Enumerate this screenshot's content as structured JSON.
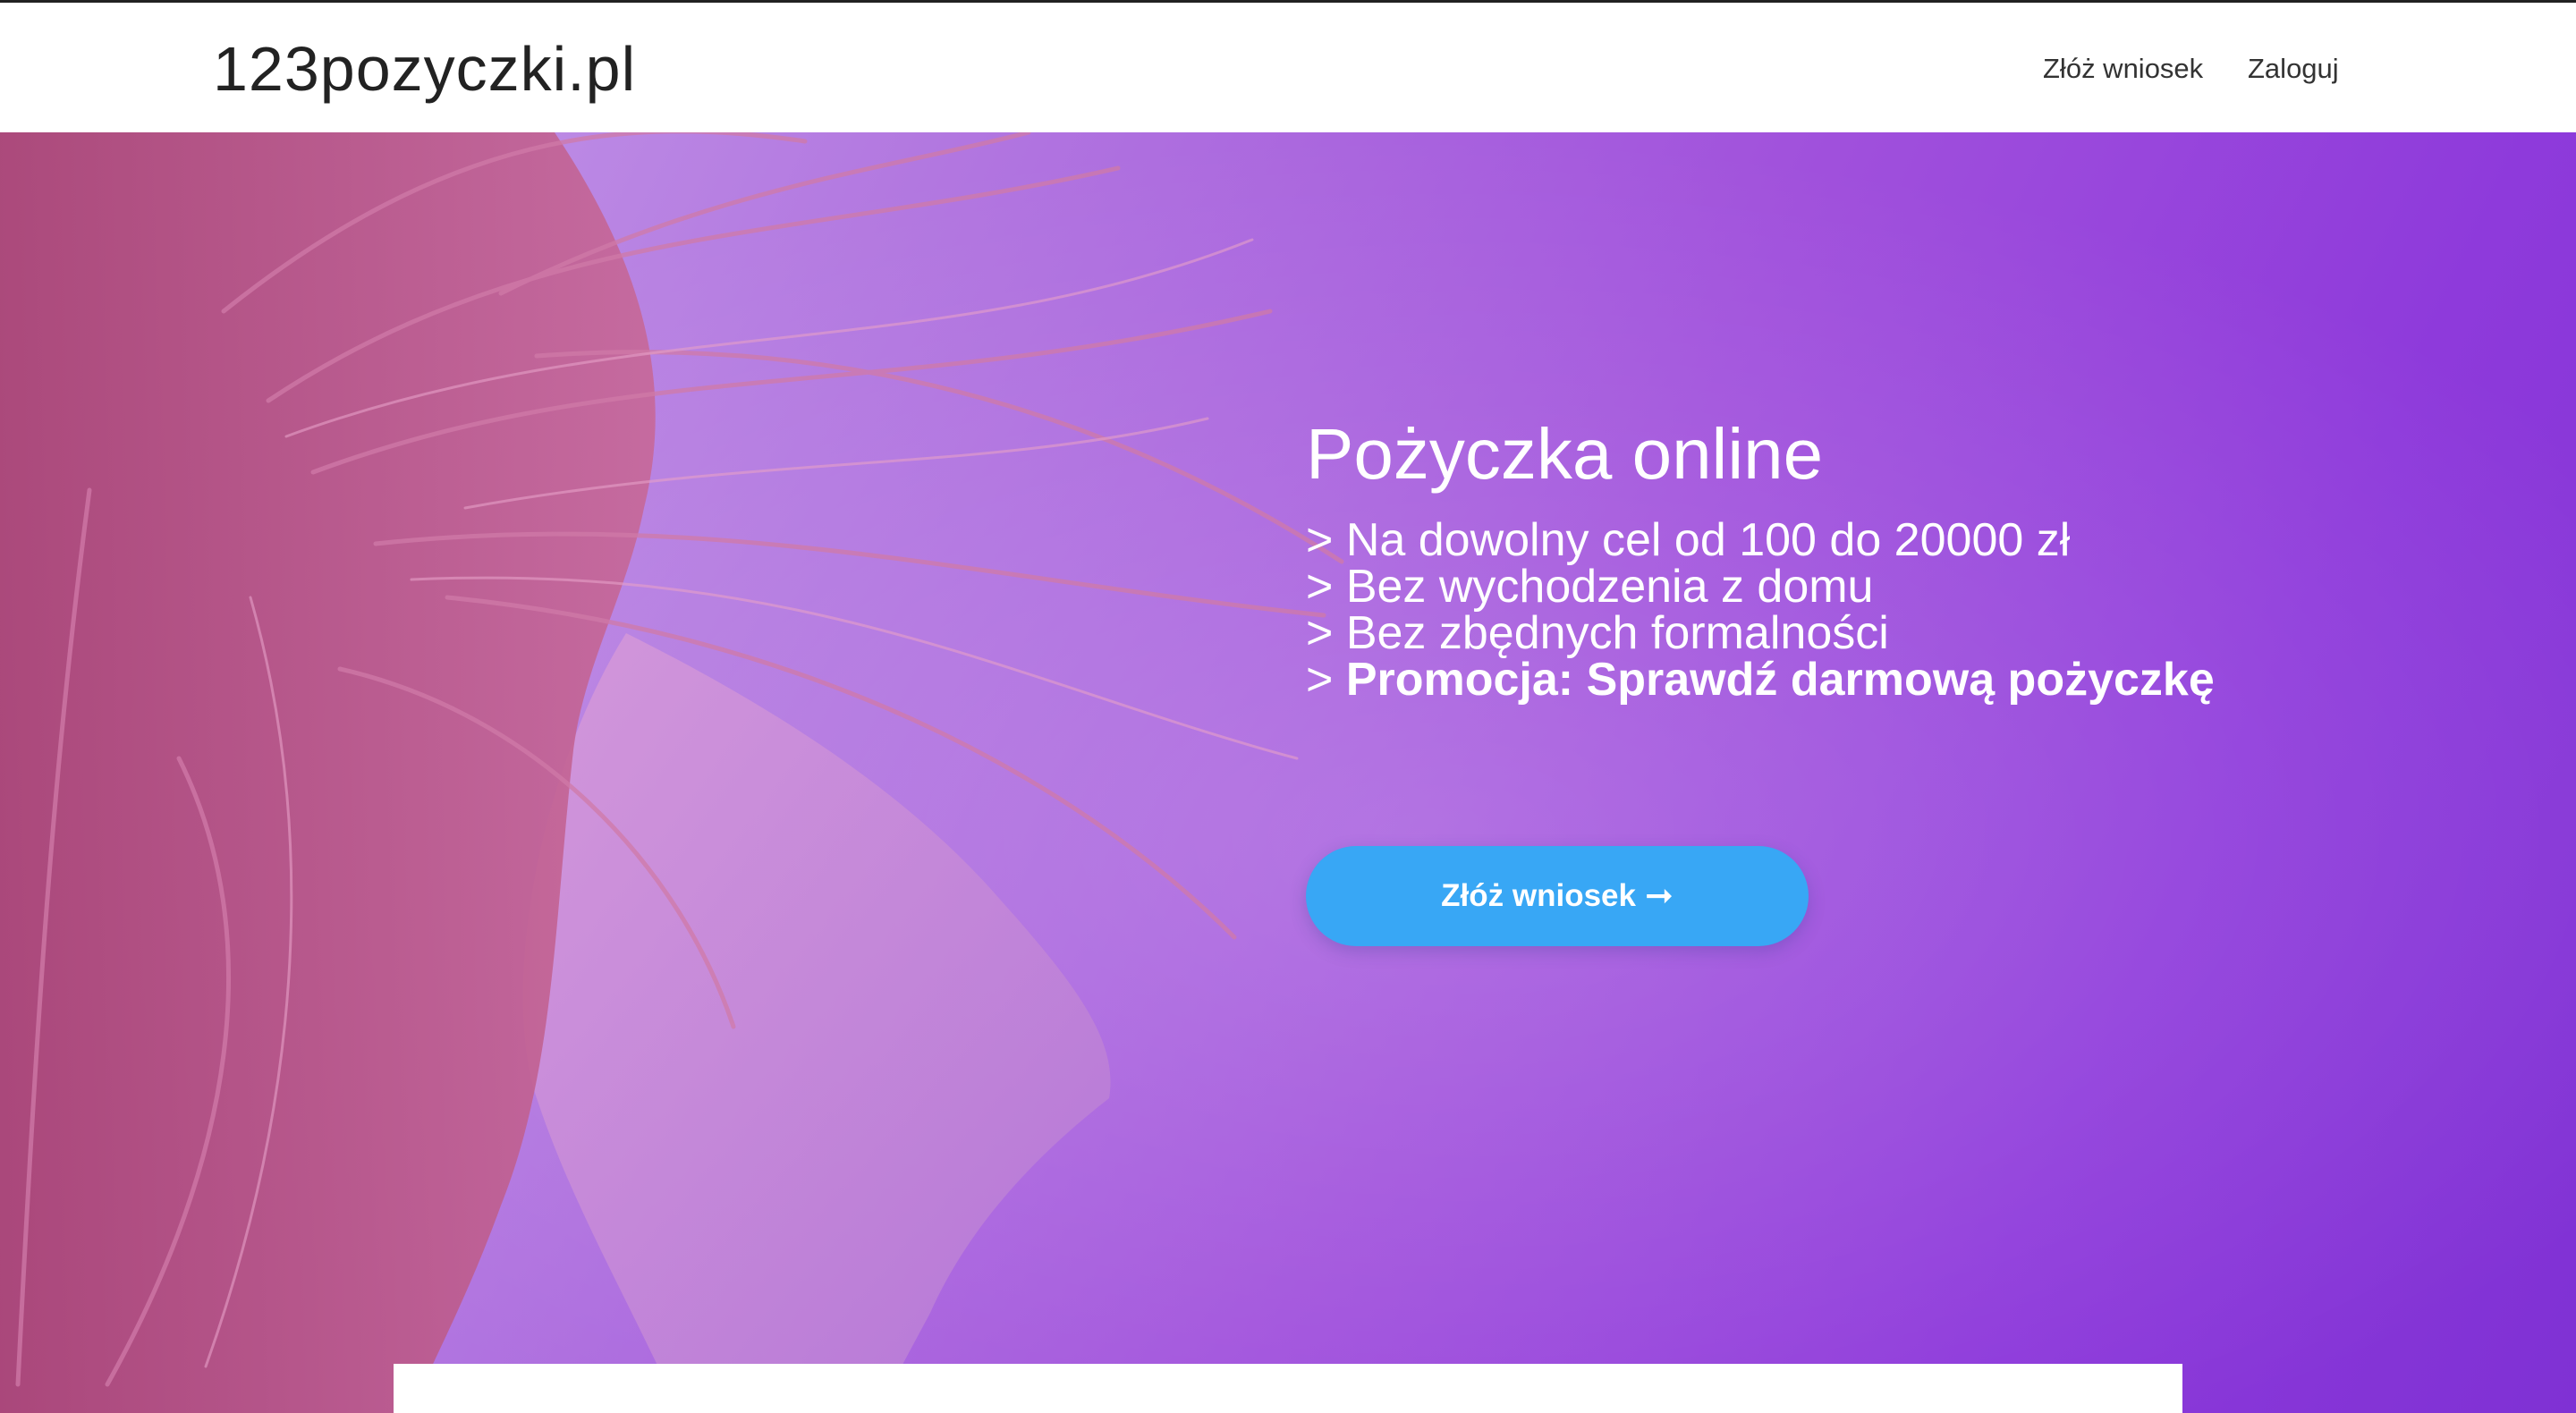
{
  "header": {
    "brand": "123pozyczki.pl",
    "nav": [
      {
        "label": "Złóż wniosek"
      },
      {
        "label": "Zaloguj"
      }
    ]
  },
  "hero": {
    "title": "Pożyczka online",
    "bullets": [
      {
        "prefix": "> ",
        "text": "Na dowolny cel od 100 do 20000 zł"
      },
      {
        "prefix": "> ",
        "text": "Bez wychodzenia z domu"
      },
      {
        "prefix": "> ",
        "text": "Bez zbędnych formalności"
      },
      {
        "prefix": "> ",
        "text": "Promocja: Sprawdź darmową pożyczkę"
      }
    ],
    "cta_label": "Złóż wniosek",
    "cta_icon": "arrow-right-icon"
  },
  "colors": {
    "header_bg": "#ffffff",
    "hero_gradient_start": "#c9a2ea",
    "hero_gradient_end": "#7f31d4",
    "hair": "#c05a8e",
    "cta_bg": "#38a7f5",
    "text_light": "#ffffff"
  }
}
